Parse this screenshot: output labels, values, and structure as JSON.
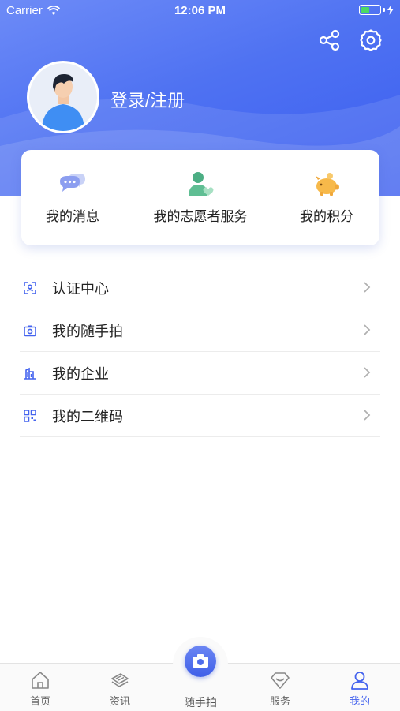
{
  "status": {
    "carrier": "Carrier",
    "time": "12:06 PM"
  },
  "profile": {
    "login_label": "登录/注册"
  },
  "quick_actions": [
    {
      "label": "我的消息",
      "icon": "message-icon"
    },
    {
      "label": "我的志愿者服务",
      "icon": "volunteer-icon"
    },
    {
      "label": "我的积分",
      "icon": "piggy-bank-icon"
    }
  ],
  "menu": [
    {
      "label": "认证中心",
      "icon": "scan-face-icon"
    },
    {
      "label": "我的随手拍",
      "icon": "camera-icon"
    },
    {
      "label": "我的企业",
      "icon": "building-icon"
    },
    {
      "label": "我的二维码",
      "icon": "qrcode-icon"
    }
  ],
  "tabbar": {
    "home": "首页",
    "news": "资讯",
    "snap": "随手拍",
    "service": "服务",
    "mine": "我的"
  },
  "colors": {
    "accent": "#4463ee",
    "header": "#4f72f2",
    "battery": "#4cd964"
  }
}
